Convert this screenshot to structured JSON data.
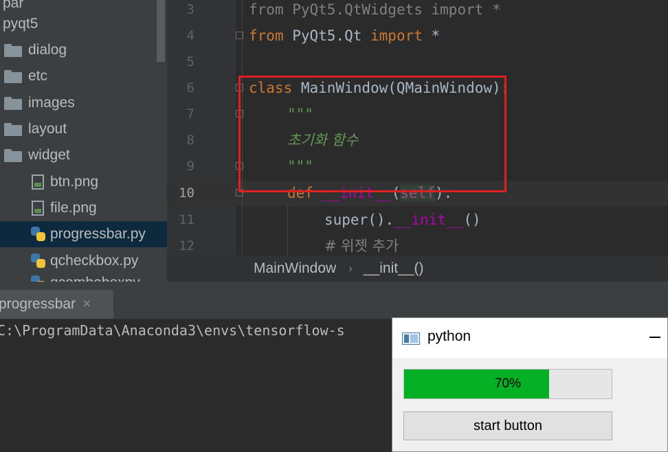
{
  "project_tree": {
    "partial_top": "par",
    "root": "pyqt5",
    "items": [
      {
        "label": "dialog",
        "type": "folder"
      },
      {
        "label": "etc",
        "type": "folder"
      },
      {
        "label": "images",
        "type": "folder"
      },
      {
        "label": "layout",
        "type": "folder"
      },
      {
        "label": "widget",
        "type": "folder"
      },
      {
        "label": "btn.png",
        "type": "image"
      },
      {
        "label": "file.png",
        "type": "image"
      },
      {
        "label": "progressbar.py",
        "type": "python",
        "selected": true
      },
      {
        "label": "qcheckbox.py",
        "type": "python"
      },
      {
        "label": "qcomboboxpy",
        "type": "python"
      }
    ]
  },
  "editor": {
    "line_numbers": [
      "3",
      "4",
      "5",
      "6",
      "7",
      "8",
      "9",
      "10",
      "11",
      "12"
    ],
    "current_line": "10",
    "lines": {
      "l3": {
        "kw1": "from",
        "mod": " PyQt5.QtWidgets ",
        "kw2": "import",
        "rest": " *"
      },
      "l4": {
        "kw1": "from",
        "mod": " PyQt5.Qt ",
        "kw2": "import",
        "rest": " *"
      },
      "l6": {
        "kw": "class",
        "rest": " MainWindow(QMainWindow):"
      },
      "l7": {
        "text": "\"\"\""
      },
      "l8": {
        "text": "초기화 함수"
      },
      "l9": {
        "text": "\"\"\""
      },
      "l10": {
        "kw": "def",
        "name": "__init__",
        "open": "(",
        "self": "self",
        "close": "):"
      },
      "l11": {
        "call": "super().",
        "name": "__init__",
        "rest": "()"
      },
      "l12": {
        "text": "# 위젯 추가"
      }
    }
  },
  "breadcrumb": {
    "items": [
      "MainWindow",
      "__init__()"
    ],
    "separator": "›"
  },
  "run_panel": {
    "tab_label": "progressbar",
    "close_symbol": "×",
    "output_line": "C:\\ProgramData\\Anaconda3\\envs\\tensorflow-s"
  },
  "app_window": {
    "title": "python",
    "progress_value": 70,
    "progress_text": "70%",
    "button_label": "start button"
  },
  "colors": {
    "keyword": "#cc7832",
    "docstring": "#629755",
    "magic": "#b200b2",
    "progress_fill": "#06b025",
    "annotation": "#e02020"
  },
  "icons": {
    "folder": "folder-icon",
    "image_file": "image-file-icon",
    "python_file": "python-file-icon",
    "app": "app-icon"
  }
}
